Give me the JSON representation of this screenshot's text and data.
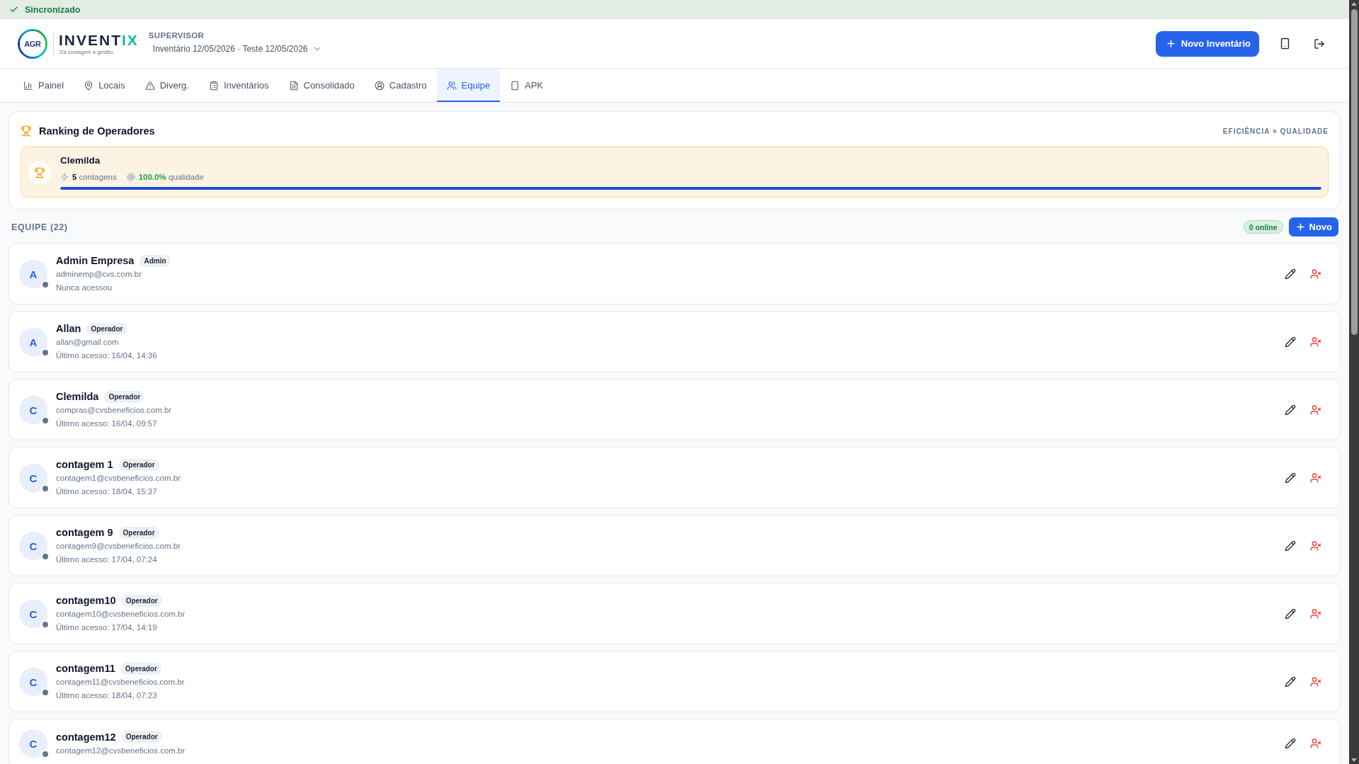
{
  "sync_status": {
    "label": "Sincronizado"
  },
  "header": {
    "logo": {
      "badge": "AGR",
      "name_main": "INVENT",
      "name_accent": "IX",
      "tagline": "Da contagem à gestão."
    },
    "role": "SUPERVISOR",
    "inventory_select": "Inventário 12/05/2026 · Teste 12/05/2026",
    "new_inventory_button": "Novo Inventário"
  },
  "tabs": [
    {
      "label": "Painel",
      "selected": false
    },
    {
      "label": "Locais",
      "selected": false
    },
    {
      "label": "Diverg.",
      "selected": false
    },
    {
      "label": "Inventários",
      "selected": false
    },
    {
      "label": "Consolidado",
      "selected": false
    },
    {
      "label": "Cadastro",
      "selected": false
    },
    {
      "label": "Equipe",
      "selected": true
    },
    {
      "label": "APK",
      "selected": false
    }
  ],
  "ranking": {
    "title": "Ranking de Operadores",
    "subtitle": "EFICIÊNCIA × QUALIDADE",
    "leaders": [
      {
        "name": "Clemilda",
        "count": "5",
        "count_label": "contagens",
        "quality": "100.0%",
        "quality_label": "qualidade",
        "level": 1
      }
    ]
  },
  "team": {
    "title": "EQUIPE (22)",
    "online_badge": "0 online",
    "new_button": "Novo",
    "members": [
      {
        "initial": "A",
        "name": "Admin Empresa",
        "role": "Admin",
        "email": "adminemp@cvs.com.br",
        "last_access": "Nunca acessou",
        "online": false
      },
      {
        "initial": "A",
        "name": "Allan",
        "role": "Operador",
        "email": "allan@gmail.com",
        "last_access": "Último acesso: 16/04, 14:36",
        "online": false
      },
      {
        "initial": "C",
        "name": "Clemilda",
        "role": "Operador",
        "email": "compras@cvsbeneficios.com.br",
        "last_access": "Último acesso: 16/04, 09:57",
        "online": false
      },
      {
        "initial": "C",
        "name": "contagem 1",
        "role": "Operador",
        "email": "contagem1@cvsbeneficios.com.br",
        "last_access": "Último acesso: 18/04, 15:37",
        "online": false
      },
      {
        "initial": "C",
        "name": "contagem 9",
        "role": "Operador",
        "email": "contagem9@cvsbeneficios.com.br",
        "last_access": "Último acesso: 17/04, 07:24",
        "online": false
      },
      {
        "initial": "C",
        "name": "contagem10",
        "role": "Operador",
        "email": "contagem10@cvsbeneficios.com.br",
        "last_access": "Último acesso: 17/04, 14:19",
        "online": false
      },
      {
        "initial": "C",
        "name": "contagem11",
        "role": "Operador",
        "email": "contagem11@cvsbeneficios.com.br",
        "last_access": "Último acesso: 18/04, 07:23",
        "online": false
      },
      {
        "initial": "C",
        "name": "contagem12",
        "role": "Operador",
        "email": "contagem12@cvsbeneficios.com.br",
        "online": false
      }
    ]
  }
}
